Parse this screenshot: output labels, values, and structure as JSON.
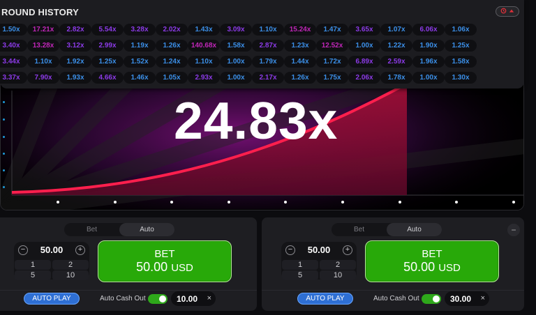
{
  "game": {
    "multiplier": "24.83x"
  },
  "history": {
    "title": "ROUND HISTORY",
    "button_icons": [
      "history-icon",
      "chevron-up-icon"
    ],
    "rows": [
      [
        {
          "v": "1.50x",
          "c": "#3b8fe8"
        },
        {
          "v": "17.21x",
          "c": "#c026b8"
        },
        {
          "v": "2.82x",
          "c": "#8b3ae6"
        },
        {
          "v": "5.54x",
          "c": "#8b3ae6"
        },
        {
          "v": "3.28x",
          "c": "#8b3ae6"
        },
        {
          "v": "2.02x",
          "c": "#8b3ae6"
        },
        {
          "v": "1.43x",
          "c": "#3b8fe8"
        },
        {
          "v": "3.09x",
          "c": "#8b3ae6"
        },
        {
          "v": "1.10x",
          "c": "#3b8fe8"
        },
        {
          "v": "15.24x",
          "c": "#c026b8"
        },
        {
          "v": "1.47x",
          "c": "#3b8fe8"
        },
        {
          "v": "3.65x",
          "c": "#8b3ae6"
        },
        {
          "v": "1.07x",
          "c": "#3b8fe8"
        },
        {
          "v": "6.06x",
          "c": "#8b3ae6"
        },
        {
          "v": "1.06x",
          "c": "#3b8fe8"
        }
      ],
      [
        {
          "v": "3.40x",
          "c": "#8b3ae6"
        },
        {
          "v": "13.28x",
          "c": "#c026b8"
        },
        {
          "v": "3.12x",
          "c": "#8b3ae6"
        },
        {
          "v": "2.99x",
          "c": "#8b3ae6"
        },
        {
          "v": "1.19x",
          "c": "#3b8fe8"
        },
        {
          "v": "1.26x",
          "c": "#3b8fe8"
        },
        {
          "v": "140.68x",
          "c": "#c026b8"
        },
        {
          "v": "1.58x",
          "c": "#3b8fe8"
        },
        {
          "v": "2.87x",
          "c": "#8b3ae6"
        },
        {
          "v": "1.23x",
          "c": "#3b8fe8"
        },
        {
          "v": "12.52x",
          "c": "#c026b8"
        },
        {
          "v": "1.00x",
          "c": "#3b8fe8"
        },
        {
          "v": "1.22x",
          "c": "#3b8fe8"
        },
        {
          "v": "1.90x",
          "c": "#3b8fe8"
        },
        {
          "v": "1.25x",
          "c": "#3b8fe8"
        }
      ],
      [
        {
          "v": "3.44x",
          "c": "#8b3ae6"
        },
        {
          "v": "1.10x",
          "c": "#3b8fe8"
        },
        {
          "v": "1.92x",
          "c": "#3b8fe8"
        },
        {
          "v": "1.25x",
          "c": "#3b8fe8"
        },
        {
          "v": "1.52x",
          "c": "#3b8fe8"
        },
        {
          "v": "1.24x",
          "c": "#3b8fe8"
        },
        {
          "v": "1.10x",
          "c": "#3b8fe8"
        },
        {
          "v": "1.00x",
          "c": "#3b8fe8"
        },
        {
          "v": "1.79x",
          "c": "#3b8fe8"
        },
        {
          "v": "1.44x",
          "c": "#3b8fe8"
        },
        {
          "v": "1.72x",
          "c": "#3b8fe8"
        },
        {
          "v": "6.89x",
          "c": "#8b3ae6"
        },
        {
          "v": "2.59x",
          "c": "#8b3ae6"
        },
        {
          "v": "1.96x",
          "c": "#3b8fe8"
        },
        {
          "v": "1.58x",
          "c": "#3b8fe8"
        }
      ],
      [
        {
          "v": "3.37x",
          "c": "#8b3ae6"
        },
        {
          "v": "7.90x",
          "c": "#8b3ae6"
        },
        {
          "v": "1.93x",
          "c": "#3b8fe8"
        },
        {
          "v": "4.66x",
          "c": "#8b3ae6"
        },
        {
          "v": "1.46x",
          "c": "#3b8fe8"
        },
        {
          "v": "1.05x",
          "c": "#3b8fe8"
        },
        {
          "v": "2.93x",
          "c": "#8b3ae6"
        },
        {
          "v": "1.00x",
          "c": "#3b8fe8"
        },
        {
          "v": "2.17x",
          "c": "#8b3ae6"
        },
        {
          "v": "1.26x",
          "c": "#3b8fe8"
        },
        {
          "v": "1.75x",
          "c": "#3b8fe8"
        },
        {
          "v": "2.06x",
          "c": "#8b3ae6"
        },
        {
          "v": "1.78x",
          "c": "#3b8fe8"
        },
        {
          "v": "1.00x",
          "c": "#3b8fe8"
        },
        {
          "v": "1.30x",
          "c": "#3b8fe8"
        }
      ]
    ]
  },
  "bet_panels": [
    {
      "tab_bet": "Bet",
      "tab_auto": "Auto",
      "amount": "50.00",
      "minus": "−",
      "plus": "+",
      "quick": [
        "1",
        "2",
        "5",
        "10"
      ],
      "bet_label": "BET",
      "bet_amount": "50.00",
      "bet_currency": "USD",
      "autoplay": "AUTO PLAY",
      "cashout_label": "Auto Cash Out",
      "cashout_value": "10.00",
      "clear": "×"
    },
    {
      "tab_bet": "Bet",
      "tab_auto": "Auto",
      "amount": "50.00",
      "minus": "−",
      "plus": "+",
      "quick": [
        "1",
        "2",
        "5",
        "10"
      ],
      "bet_label": "BET",
      "bet_amount": "50.00",
      "bet_currency": "USD",
      "autoplay": "AUTO PLAY",
      "cashout_label": "Auto Cash Out",
      "cashout_value": "30.00",
      "clear": "×",
      "remove": "−"
    }
  ],
  "colors": {
    "accent_green": "#28a909",
    "accent_blue": "#2e6fd4",
    "curve": "#e0123e"
  }
}
